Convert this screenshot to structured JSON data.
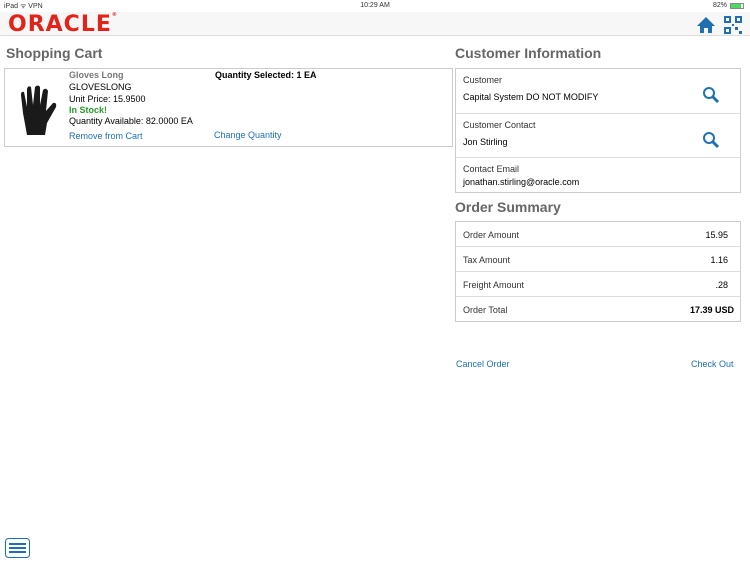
{
  "status": {
    "device": "iPad",
    "vpn": "VPN",
    "time": "10:29 AM",
    "battery": "82%"
  },
  "header": {
    "logo": "ORACLE"
  },
  "cart": {
    "title": "Shopping Cart",
    "item": {
      "name": "Gloves Long",
      "code": "GLOVESLONG",
      "unit_price": "Unit Price: 15.9500",
      "stock": "In Stock!",
      "available": "Quantity Available: 82.0000 EA",
      "qty_selected": "Quantity Selected: 1 EA",
      "remove": "Remove from Cart",
      "change": "Change Quantity"
    }
  },
  "customer": {
    "title": "Customer Information",
    "customer_label": "Customer",
    "customer_value": "Capital System DO NOT MODIFY",
    "contact_label": "Customer Contact",
    "contact_value": "Jon Stirling",
    "email_label": "Contact Email",
    "email_value": "jonathan.stirling@oracle.com"
  },
  "summary": {
    "title": "Order Summary",
    "rows": [
      {
        "label": "Order Amount",
        "value": "15.95"
      },
      {
        "label": "Tax Amount",
        "value": "1.16"
      },
      {
        "label": "Freight Amount",
        "value": ".28"
      },
      {
        "label": "Order Total",
        "value": "17.39 USD"
      }
    ]
  },
  "actions": {
    "cancel": "Cancel Order",
    "checkout": "Check Out"
  },
  "colors": {
    "accent": "#1f6fb2",
    "brand": "#e2231a",
    "stock": "#2a9a2a"
  }
}
